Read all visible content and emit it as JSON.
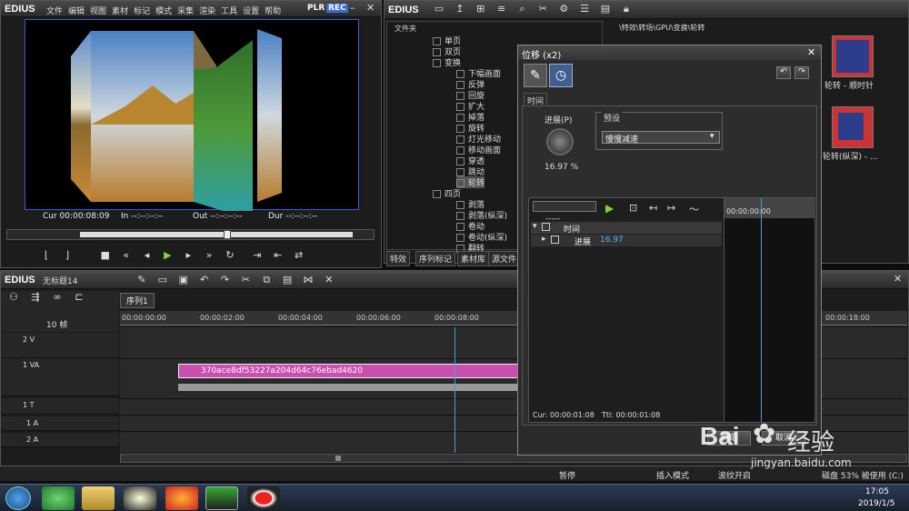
{
  "player": {
    "app": "EDIUS",
    "menu": [
      "文件",
      "编辑",
      "视图",
      "素材",
      "标记",
      "模式",
      "采集",
      "渲染",
      "工具",
      "设置",
      "帮助"
    ],
    "plr": "PLR",
    "rec": "REC",
    "cur": "Cur 00:00:08:09",
    "in": "In --:--:--:--",
    "out": "Out --:--:--:--",
    "dur": "Dur --:--:--:--"
  },
  "bin": {
    "app": "EDIUS",
    "folder_label": "文件夹",
    "path": "\\特效\\转场\\GPU\\变换\\轮转",
    "tree": [
      {
        "label": "单页",
        "indent": 0
      },
      {
        "label": "双页",
        "indent": 0
      },
      {
        "label": "变换",
        "indent": 0
      },
      {
        "label": "下幅画面",
        "indent": 1
      },
      {
        "label": "反弹",
        "indent": 1
      },
      {
        "label": "回旋",
        "indent": 1
      },
      {
        "label": "扩大",
        "indent": 1
      },
      {
        "label": "掉落",
        "indent": 1
      },
      {
        "label": "旋转",
        "indent": 1
      },
      {
        "label": "灯光移动",
        "indent": 1
      },
      {
        "label": "移动画面",
        "indent": 1
      },
      {
        "label": "穿透",
        "indent": 1
      },
      {
        "label": "跳动",
        "indent": 1
      },
      {
        "label": "轮转",
        "indent": 1
      },
      {
        "label": "四页",
        "indent": 0
      },
      {
        "label": "剥落",
        "indent": 1
      },
      {
        "label": "剥落(纵深)",
        "indent": 1
      },
      {
        "label": "卷动",
        "indent": 1
      },
      {
        "label": "卷动(纵深)",
        "indent": 1
      },
      {
        "label": "翻转",
        "indent": 1
      }
    ],
    "tabs": [
      "特效",
      "序列标记",
      "素材库",
      "源文件"
    ],
    "thumbs": [
      {
        "label": "轮转 - 顺时针"
      },
      {
        "label": "轮转(纵深) - ..."
      }
    ]
  },
  "dialog": {
    "title": "位移 (x2)",
    "tab": "时间",
    "progress_label": "进展(P)",
    "progress_value": "16.97 %",
    "preset_group": "预设",
    "preset_value": "慢慢减速",
    "timecode_field": "-----",
    "track_time": "时间",
    "track_progress": "进展",
    "track_progress_value": "16.97",
    "ruler_time": "00:00:00:00",
    "cur": "Cur: 00:00:01:08",
    "ttl": "Ttl: 00:00:01:08",
    "ok": "确定",
    "cancel": "取消"
  },
  "timeline": {
    "app": "EDIUS",
    "project": "无标题14",
    "sequence_tab": "序列1",
    "frames": "10 帧",
    "ruler": [
      "00:00:00:00",
      "00:00:02:00",
      "00:00:04:00",
      "00:00:06:00",
      "00:00:08:00",
      "00:00:18:00"
    ],
    "tracks": [
      "2 V",
      "1 VA",
      "1 T",
      "1 A",
      "2 A"
    ],
    "clip_name": "370ace8df53227a204d64c76ebad4620"
  },
  "status": {
    "pause": "暂停",
    "insert_mode": "插入模式",
    "ripple": "波纹开启",
    "disk": "磁盘 53% 被使用 (C:)"
  },
  "taskbar": {
    "time": "17:05",
    "date": "2019/1/5"
  },
  "watermark": {
    "brand": "Bai",
    "brand2": "经验",
    "url": "jingyan.baidu.com"
  },
  "colors": {
    "clip": "#c94fb0",
    "accent_green": "#7ad33d",
    "rec_blue": "#3a6ad4"
  }
}
